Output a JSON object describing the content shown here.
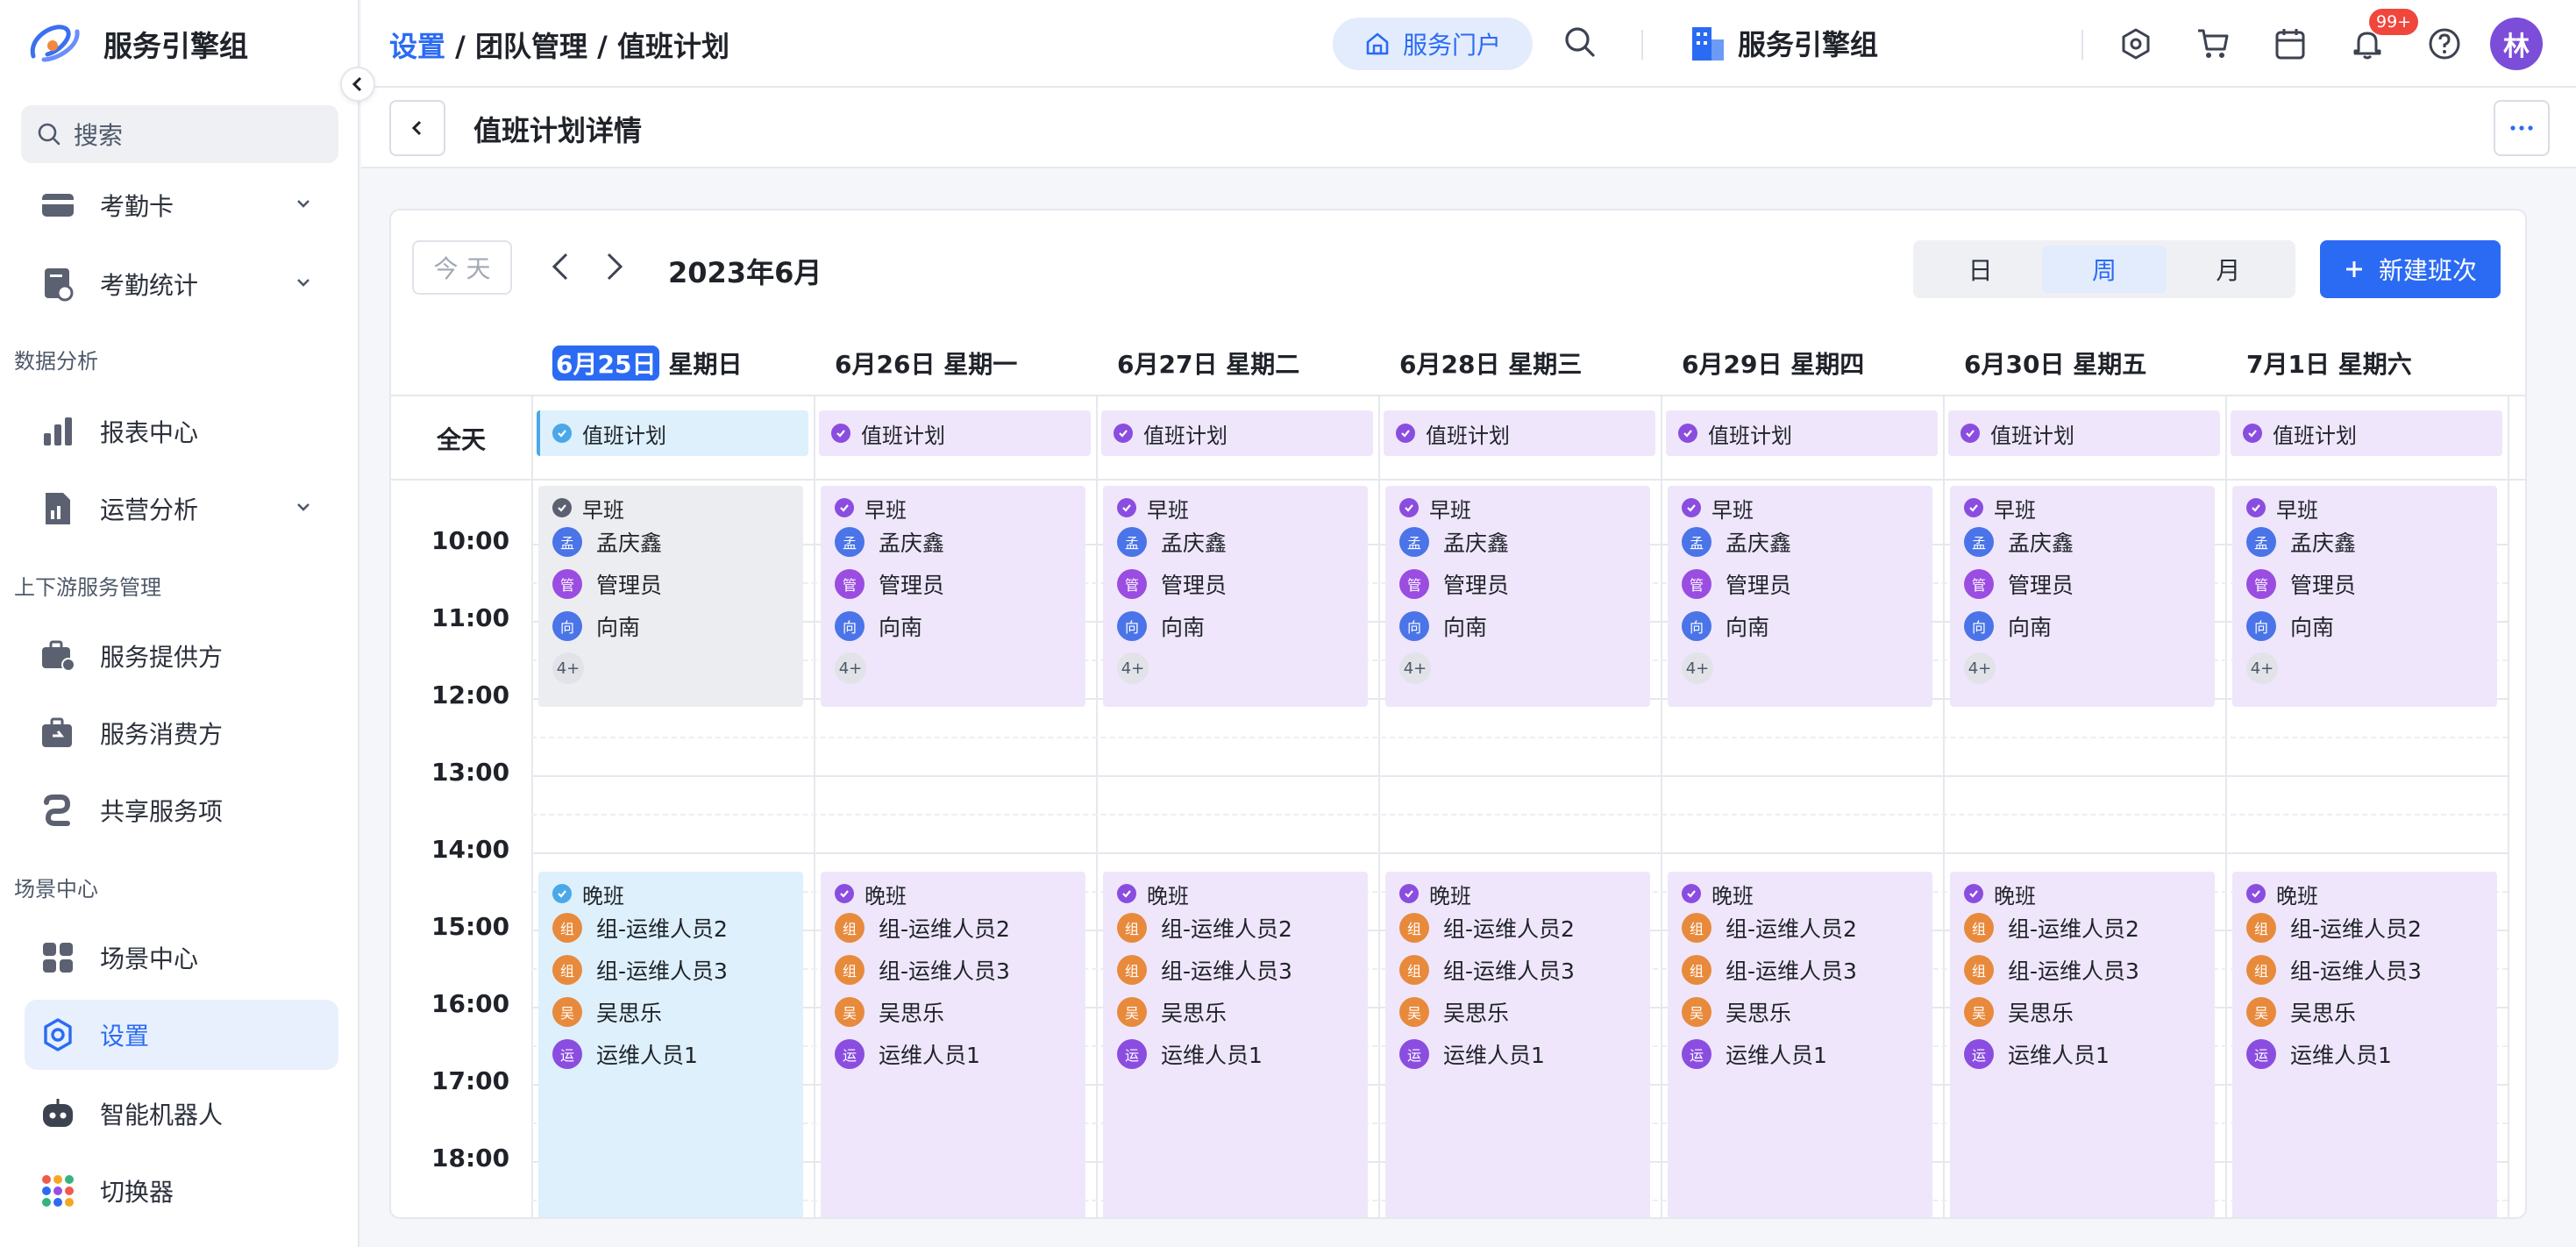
{
  "app": {
    "name": "服务引擎组"
  },
  "sidebar": {
    "search_placeholder": "搜索",
    "items": [
      {
        "label": "考勤卡",
        "has_chevron": true
      },
      {
        "label": "考勤统计",
        "has_chevron": true
      },
      {
        "label": "报表中心"
      },
      {
        "label": "运营分析",
        "has_chevron": true
      },
      {
        "label": "服务提供方"
      },
      {
        "label": "服务消费方"
      },
      {
        "label": "共享服务项"
      },
      {
        "label": "场景中心"
      },
      {
        "label": "设置",
        "active": true
      },
      {
        "label": "智能机器人"
      },
      {
        "label": "切换器"
      }
    ],
    "sections": [
      "数据分析",
      "上下游服务管理",
      "场景中心"
    ]
  },
  "topbar": {
    "breadcrumb": {
      "link": "设置",
      "sep": " / ",
      "mid": "团队管理",
      "current": "值班计划"
    },
    "portal_label": "服务门户",
    "org_name": "服务引擎组",
    "notification_count": "99+",
    "avatar_text": "林"
  },
  "subheader": {
    "title": "值班计划详情"
  },
  "calendar": {
    "today_label": "今 天",
    "month_title": "2023年6月",
    "views": [
      "日",
      "周",
      "月"
    ],
    "selected_view": "周",
    "new_button": "新建班次",
    "allday_label": "全天",
    "days": [
      {
        "date": "6月25日",
        "weekday": "星期日",
        "today": true
      },
      {
        "date": "6月26日",
        "weekday": "星期一"
      },
      {
        "date": "6月27日",
        "weekday": "星期二"
      },
      {
        "date": "6月28日",
        "weekday": "星期三"
      },
      {
        "date": "6月29日",
        "weekday": "星期四"
      },
      {
        "date": "6月30日",
        "weekday": "星期五"
      },
      {
        "date": "7月1日",
        "weekday": "星期六"
      }
    ],
    "allday_event": "值班计划",
    "hours": [
      "10:00",
      "11:00",
      "12:00",
      "13:00",
      "14:00",
      "15:00",
      "16:00",
      "17:00",
      "18:00"
    ],
    "morning_shift": {
      "title": "早班",
      "members": [
        {
          "avatar": "孟",
          "name": "孟庆鑫",
          "color": "#4a74e8"
        },
        {
          "avatar": "管",
          "name": "管理员",
          "color": "#9a4de0"
        },
        {
          "avatar": "向",
          "name": "向南",
          "color": "#4a74e8"
        }
      ],
      "more": "4+"
    },
    "evening_shift": {
      "title": "晚班",
      "members": [
        {
          "avatar": "组",
          "name": "组-运维人员2",
          "color": "#e88a3c"
        },
        {
          "avatar": "组",
          "name": "组-运维人员3",
          "color": "#e88a3c"
        },
        {
          "avatar": "吴",
          "name": "吴思乐",
          "color": "#e88a3c"
        },
        {
          "avatar": "运",
          "name": "运维人员1",
          "color": "#8a4de0"
        }
      ]
    },
    "colors": {
      "today_bg": "#ddf0fc",
      "event_bg": "#efe6fb",
      "past_bg": "#ecedf0",
      "accent": "#2b6bf3"
    }
  }
}
